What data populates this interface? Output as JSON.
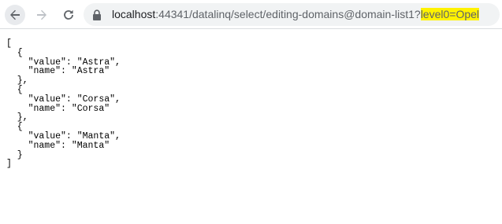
{
  "browser": {
    "url": {
      "host": "localhost",
      "path": ":44341/datalinq/select/editing-domains@domain-list1?",
      "highlighted_query": "level0=Opel"
    },
    "icons": {
      "back": "arrow-left-icon",
      "forward": "arrow-right-icon",
      "reload": "reload-icon",
      "lock": "lock-icon"
    }
  },
  "colors": {
    "highlight": "#fff200",
    "omnibox_bg": "#f1f3f4",
    "url_gray": "#5f6368"
  },
  "json_lines": [
    "[",
    "  {",
    "    \"value\": \"Astra\",",
    "    \"name\": \"Astra\"",
    "  },",
    "  {",
    "    \"value\": \"Corsa\",",
    "    \"name\": \"Corsa\"",
    "  },",
    "  {",
    "    \"value\": \"Manta\",",
    "    \"name\": \"Manta\"",
    "  }",
    "]"
  ]
}
